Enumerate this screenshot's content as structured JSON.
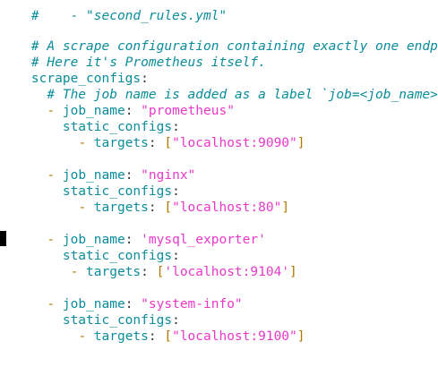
{
  "editor": {
    "partial_top_line": "#    - \"second_rules.yml\"",
    "comment1": "# A scrape configuration containing exactly one endpoint to scrape:",
    "comment2": "# Here it's Prometheus itself.",
    "scrape_key": "scrape_configs",
    "comment3": "# The job name is added as a label `job=<job_name>` to any timeseries scraped from this config.",
    "jobs": [
      {
        "job_name": "\"prometheus\"",
        "targets": "\"localhost:9090\""
      },
      {
        "job_name": "\"nginx\"",
        "targets": "\"localhost:80\""
      },
      {
        "job_name": "'mysql_exporter'",
        "targets": "'localhost:9104'"
      },
      {
        "job_name": "\"system-info\"",
        "targets": "\"localhost:9100\""
      }
    ],
    "labels": {
      "job_name": "job_name",
      "static_configs": "static_configs",
      "targets": "targets",
      "dash": "-",
      "colon": ":",
      "lbracket": "[",
      "rbracket": "]"
    }
  }
}
